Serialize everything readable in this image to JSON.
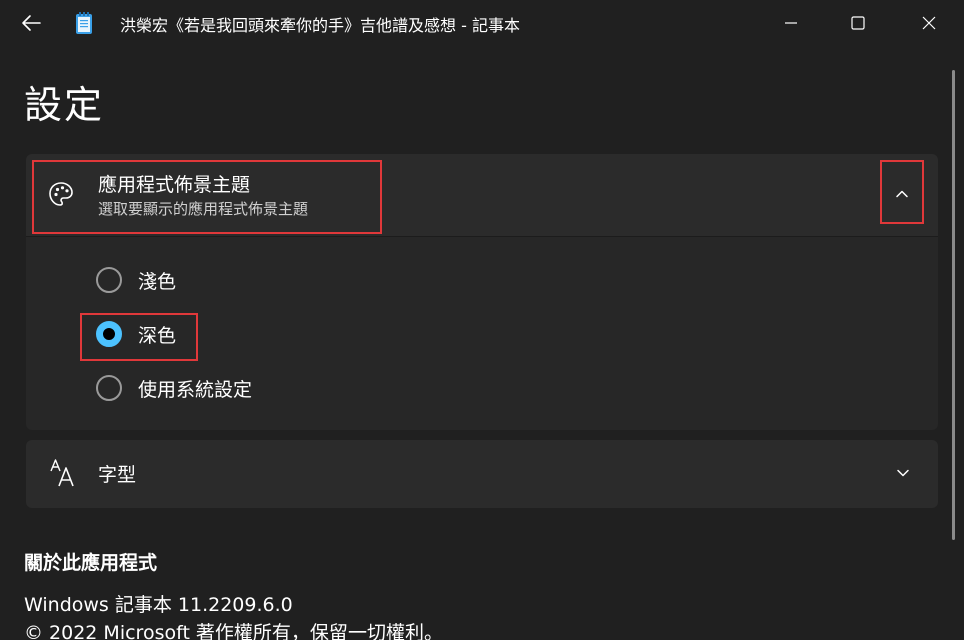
{
  "window": {
    "title": "洪榮宏《若是我回頭來牽你的手》吉他譜及感想 - 記事本"
  },
  "page": {
    "title": "設定"
  },
  "theme_setting": {
    "title": "應用程式佈景主題",
    "description": "選取要顯示的應用程式佈景主題",
    "expanded": true,
    "options": [
      {
        "label": "淺色",
        "selected": false
      },
      {
        "label": "深色",
        "selected": true
      },
      {
        "label": "使用系統設定",
        "selected": false
      }
    ]
  },
  "font_setting": {
    "title": "字型",
    "expanded": false
  },
  "about": {
    "heading": "關於此應用程式",
    "version": "Windows 記事本 11.2209.6.0",
    "copyright": "© 2022 Microsoft 著作權所有，保留一切權利。"
  },
  "colors": {
    "background": "#202020",
    "card": "#2b2b2b",
    "accent": "#4cc2ff",
    "highlight": "#e0383a"
  }
}
